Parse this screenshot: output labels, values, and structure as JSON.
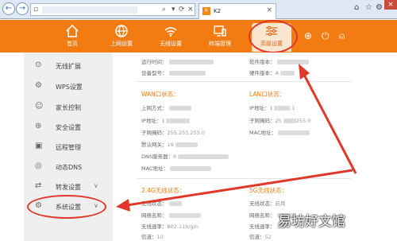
{
  "browser": {
    "tab_title": "K2",
    "back_icon": "back-arrow-icon",
    "forward_icon": "forward-arrow-icon"
  },
  "nav": {
    "items": [
      {
        "label": "首页",
        "icon": "home-icon"
      },
      {
        "label": "上网设置",
        "icon": "globe-icon"
      },
      {
        "label": "无线设置",
        "icon": "wifi-icon"
      },
      {
        "label": "终端管理",
        "icon": "devices-icon"
      },
      {
        "label": "高级设置",
        "icon": "sliders-icon",
        "active": true
      }
    ],
    "right_icons": [
      "add-icon",
      "power-icon",
      "user-icon"
    ]
  },
  "sidebar": {
    "items": [
      {
        "label": "无线扩展",
        "icon": "wireless-extend-icon"
      },
      {
        "label": "WPS设置",
        "icon": "wps-icon"
      },
      {
        "label": "家长控制",
        "icon": "parental-control-icon"
      },
      {
        "label": "安全设置",
        "icon": "shield-icon"
      },
      {
        "label": "远程管理",
        "icon": "remote-icon"
      },
      {
        "label": "动态DNS",
        "icon": "dns-icon"
      },
      {
        "label": "转发设置",
        "icon": "forward-icon",
        "chevron": "∨"
      },
      {
        "label": "系统设置",
        "icon": "gear-icon",
        "chevron": "∨"
      }
    ]
  },
  "main": {
    "top": {
      "run_time": "运行时间：",
      "device_no": "设备型号：",
      "software": "软件版本：",
      "hardware": "硬件版本：",
      "hardware_val": "A"
    },
    "wan": {
      "title": "WAN口状态：",
      "conn": "上网方式：",
      "ip": "IP地址：",
      "ip_val": "1",
      "mask": "子网掩码：",
      "mask_val": "255.255.255.0",
      "gateway": "默认网关：",
      "gateway_val": "19",
      "dns": "DNS服务器：",
      "dns_val": "6",
      "mac": "MAC地址："
    },
    "lan": {
      "title": "LAN口状态：",
      "ip": "IP地址：",
      "ip_val": "1",
      "ip_tail": ".1",
      "mask": "子网掩码：",
      "mask_val": "25",
      "mask_tail": "255.0",
      "mac": "MAC地址："
    },
    "w24": {
      "title": "2.4G无线状态：",
      "state": "无线状态：",
      "ssid": "网络名称：",
      "rate": "无线速率：",
      "rate_val": "802.11b/g/n",
      "channel": "信道：",
      "channel_val": "10"
    },
    "w5": {
      "title": "5G无线状态：",
      "state": "无线状态：",
      "state_val": "启用",
      "ssid": "网络名称：",
      "rate": "无线速率：",
      "channel": "信道：",
      "channel_val": "52"
    }
  },
  "watermark": "易坊好文馆",
  "colors": {
    "accent": "#f37c12",
    "annotation": "#e0392b"
  }
}
